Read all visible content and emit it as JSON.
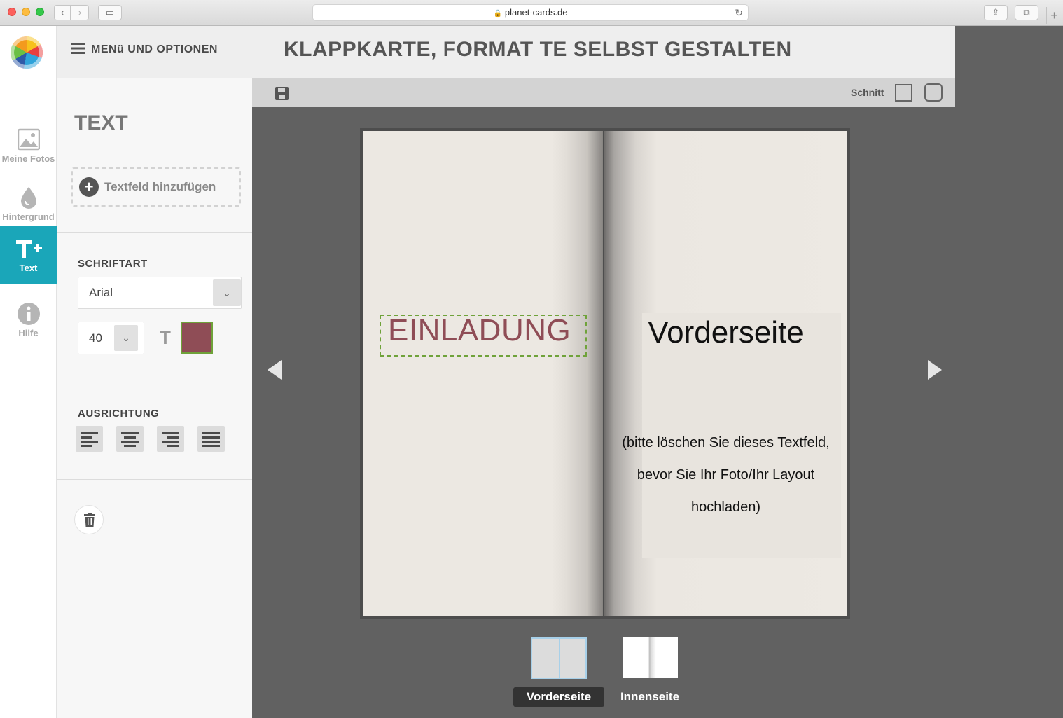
{
  "browser": {
    "url": "planet-cards.de"
  },
  "rail": {
    "items": [
      {
        "label": "Meine Fotos",
        "icon": "image-icon"
      },
      {
        "label": "Hintergrund",
        "icon": "drop-icon"
      },
      {
        "label": "Text",
        "icon": "text-plus-icon",
        "active": true
      },
      {
        "label": "Hilfe",
        "icon": "info-icon"
      }
    ]
  },
  "header": {
    "menu_label": "MENü UND OPTIONEN",
    "title": "KLAPPKARTE, FORMAT TE SELBST GESTALTEN"
  },
  "panel": {
    "title": "TEXT",
    "add_text_label": "Textfeld hinzufügen",
    "font_section": "SCHRIFTART",
    "font_value": "Arial",
    "size_value": "40",
    "color_glyph": "T",
    "text_color": "#8f4d56",
    "align_section": "AUSRICHTUNG"
  },
  "toolbar": {
    "schnitt_label": "Schnitt"
  },
  "card": {
    "left_text": "EINLADUNG",
    "right_title": "Vorderseite",
    "right_hint_lines": [
      "(bitte löschen Sie dieses Textfeld,",
      "bevor Sie Ihr Foto/Ihr Layout",
      "hochladen)"
    ]
  },
  "pages": {
    "front_label": "Vorderseite",
    "inner_label": "Innenseite"
  },
  "colors": {
    "accent": "#1aa6b9",
    "selection": "#6fa23a"
  }
}
